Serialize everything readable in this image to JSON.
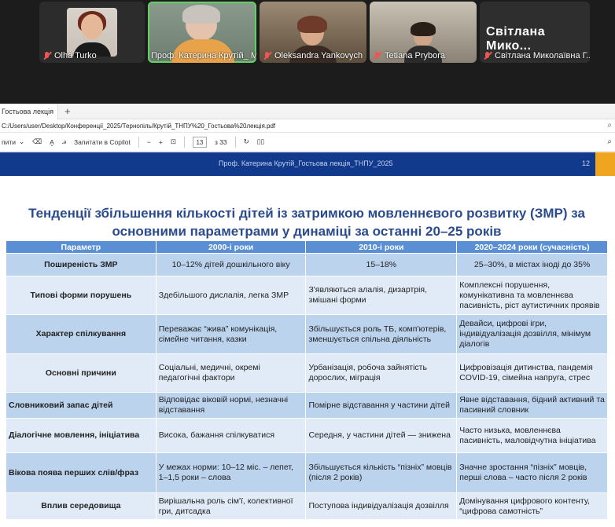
{
  "participants": [
    {
      "name": "Olha Turko"
    },
    {
      "name": "Проф. Катерина Крутій_ М..."
    },
    {
      "name": "Oleksandra Yankovych"
    },
    {
      "name": "Tetiana Prybora"
    },
    {
      "name": "Світлана Миколаївна Г...",
      "large_name": "Світлана Мико..."
    }
  ],
  "browser": {
    "tab_label": "Гостьова лекція",
    "address": "C:/Users/user/Desktop/Конференції_2025/Тернопіль/Крутій_ТНПУ%20_Гостьова%20лекція.pdf",
    "toolbar": {
      "draw_label": "пити",
      "copilot_label": "Запитати в Copilot",
      "page_current": "13",
      "page_total": "з 33"
    }
  },
  "slide": {
    "footer_text": "Проф. Катерина Крутій_Гостьова лекція_ТНПУ_2025",
    "page_number": "12",
    "title_line1": "Тенденції збільшення кількості дітей із затримкою мовленнєвого розвитку (ЗМР) за",
    "title_line2": "основними параметрами у динаміці за останні 20–25 років",
    "headers": [
      "Параметр",
      "2000-і роки",
      "2010-і роки",
      "2020–2024 роки (сучасність)"
    ],
    "rows": [
      [
        "Поширеність ЗМР",
        "10–12% дітей дошкільного віку",
        "15–18%",
        "25–30%, в містах іноді до 35%"
      ],
      [
        "Типові форми порушень",
        "Здебільшого дислалія, легка ЗМР",
        "З'являються алалія, дизартрія, змішані форми",
        "Комплексні порушення, комунікативна та мовленнєва пасивність, ріст аутистичних проявів"
      ],
      [
        "Характер спілкування",
        "Переважає “жива” комунікація, сімейне читання, казки",
        "Збільшується роль ТБ, комп'ютерів, зменшується спільна діяльність",
        "Девайси, цифрові ігри, індивідуалізація дозвілля, мінімум діалогів"
      ],
      [
        "Основні причини",
        "Соціальні, медичні, окремі педагогічні фактори",
        "Урбанізація, робоча зайнятість дорослих, міграція",
        "Цифровізація дитинства, пандемія COVID-19, сімейна напруга, стрес"
      ],
      [
        "Словниковий запас дітей",
        "Відповідає віковій нормі, незначні відставання",
        "Помірне відставання у частини дітей",
        "Явне відставання, бідний активний та пасивний словник"
      ],
      [
        "Діалогічне мовлення, ініціатива",
        "Висока, бажання спілкуватися",
        "Середня, у частини дітей — знижена",
        "Часто низька, мовленнєва пасивність, маловідчутна ініціатива"
      ],
      [
        "Вікова поява перших слів/фраз",
        "У межах норми: 10–12 міс. – лепет, 1–1,5 роки – слова",
        "Збільшується кількість “пізніх” мовців (після 2 років)",
        "Значне зростання “пізніх” мовців, перші слова – часто після 2 років"
      ],
      [
        "Вплив середовища",
        "Вирішальна роль сім'ї, колективної гри, дитсадка",
        "Поступова індивідуалізація дозвілля",
        "Домінування цифрового контенту, “цифрова самотність”"
      ]
    ]
  },
  "colors": {
    "slide_header": "#123a8c",
    "slide_accent": "#f0a520",
    "title": "#2a4b8d",
    "table_header": "#5a8fd6",
    "row_odd": "#bcd3ee",
    "row_even": "#e1ebf7",
    "active_speaker": "#5fd35f",
    "mic_muted": "#ee5555"
  }
}
